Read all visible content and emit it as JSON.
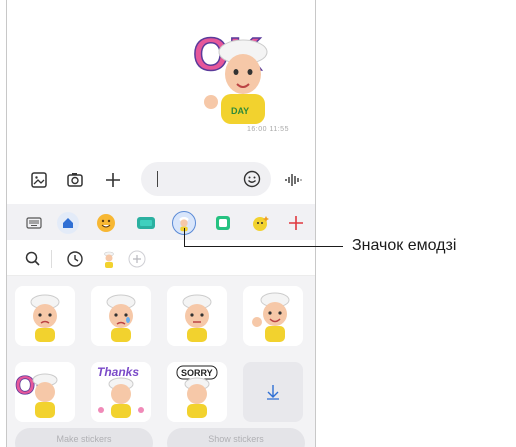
{
  "chat": {
    "message_time": "16:00 11:55"
  },
  "composer": {
    "gallery_icon": "image-icon",
    "camera_icon": "camera-icon",
    "add_icon": "plus-icon",
    "emoji_icon": "smiley-icon",
    "voice_icon": "waveform-icon"
  },
  "tabs": [
    {
      "name": "keyboard-icon"
    },
    {
      "name": "home-icon"
    },
    {
      "name": "emoji-face-icon"
    },
    {
      "name": "gif-icon"
    },
    {
      "name": "ar-emoji-icon",
      "active": true
    },
    {
      "name": "bitmoji-icon"
    },
    {
      "name": "sticker-sparkle-icon"
    },
    {
      "name": "add-icon"
    }
  ],
  "subbar": {
    "search_icon": "search-icon",
    "recent_icon": "clock-icon",
    "avatar_icon": "avatar-icon",
    "add_icon": "plus-icon"
  },
  "stickers": [
    {
      "name": "sticker-sad"
    },
    {
      "name": "sticker-crying"
    },
    {
      "name": "sticker-neutral"
    },
    {
      "name": "sticker-waving"
    },
    {
      "name": "sticker-ok",
      "text": "OK"
    },
    {
      "name": "sticker-thanks",
      "text": "Thanks"
    },
    {
      "name": "sticker-sorry",
      "text": "SORRY"
    }
  ],
  "bottom_buttons": {
    "left": "Make stickers",
    "right": "Show stickers"
  },
  "callout": {
    "label": "Значок емодзі"
  },
  "colors": {
    "accent_blue": "#2f6fd4",
    "plus_red": "#e0383e",
    "sticker_pink": "#e6579a",
    "sticker_yellow": "#f2d22e"
  }
}
